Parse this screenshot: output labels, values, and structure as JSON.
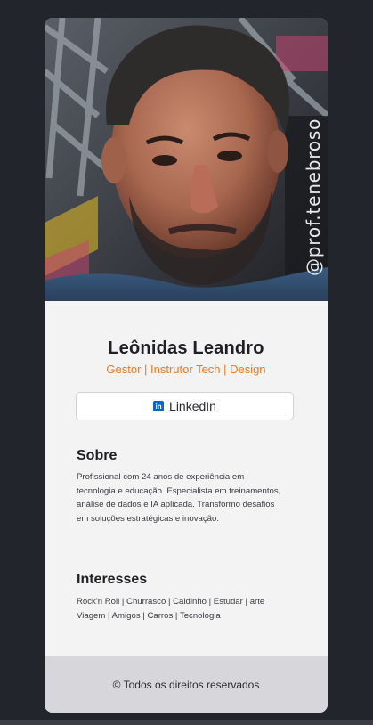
{
  "profile": {
    "watermark": "@prof.tenebroso",
    "name": "Leônidas Leandro",
    "role": "Gestor | Instrutor Tech | Design"
  },
  "links": {
    "linkedin_label": "LinkedIn",
    "linkedin_icon": "linkedin-icon"
  },
  "about": {
    "title": "Sobre",
    "lines": [
      "Profissional com 24 anos de experiência em",
      "tecnologia e educação. Especialista em treinamentos,",
      "análise de dados e IA aplicada. Transformo desafios",
      "em soluções estratégicas e inovação."
    ]
  },
  "interests": {
    "title": "Interesses",
    "lines": [
      "Rock'n Roll | Churrasco | Caldinho | Estudar | arte",
      "Viagem | Amigos | Carros | Tecnologia"
    ]
  },
  "footer": {
    "text": "© Todos os direitos reservados"
  },
  "colors": {
    "background": "#22252c",
    "card": "#f3f3f4",
    "accent": "#e87a24",
    "footer": "#d6d6db",
    "linkedin": "#0a66c2"
  }
}
